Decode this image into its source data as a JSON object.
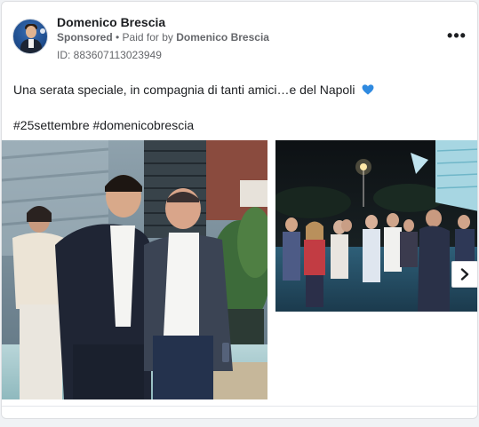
{
  "ad": {
    "advertiser_name": "Domenico Brescia",
    "sponsored_label": "Sponsored",
    "separator": " • ",
    "paid_for_prefix": "Paid for by ",
    "paid_for_name": "Domenico Brescia",
    "ad_id": "ID: 883607113023949",
    "more_icon": "more-horizontal-icon"
  },
  "post": {
    "text_line1": "Una serata speciale, in compagnia di tanti amici…e del Napoli",
    "heart_emoji": "blue-heart-icon",
    "hashtags": "#25settembre #domenicobrescia"
  },
  "carousel": {
    "cards": [
      {
        "image": "two-men-posing-at-evening-event"
      },
      {
        "image": "crowd-at-evening-party"
      }
    ],
    "next_icon": "chevron-right-icon"
  },
  "colors": {
    "heart": "#2f8ae0",
    "text": "#1c1e21",
    "secondary": "#65676b"
  }
}
